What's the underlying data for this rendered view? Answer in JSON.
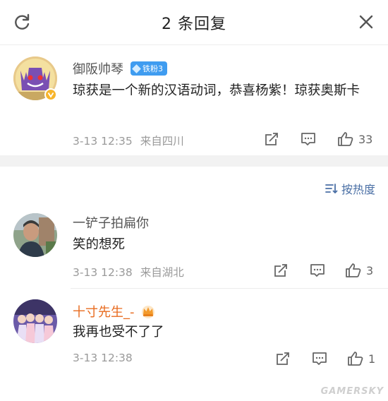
{
  "header": {
    "title": "2 条回复",
    "refresh_icon": "refresh-icon",
    "close_icon": "close-icon"
  },
  "main_comment": {
    "author": "御阪帅琴",
    "fan_badge": "铁粉3",
    "content": "琼获是一个新的汉语动词，恭喜杨紫！琼获奥斯卡",
    "time": "3-13 12:35",
    "location": "来自四川",
    "likes": "33"
  },
  "sort": {
    "label": "按热度"
  },
  "replies": [
    {
      "author": "一铲子拍扁你",
      "content": "笑的想死",
      "time": "3-13 12:38",
      "location": "来自湖北",
      "likes": "3"
    },
    {
      "author": "十寸先生_-",
      "content": "我再也受不了了",
      "time": "3-13 12:38",
      "location": "",
      "likes": "1"
    }
  ],
  "watermark": "GAMERSKY",
  "colors": {
    "link_blue": "#4a6fa5",
    "badge_blue": "#3f9cf0",
    "vip_orange": "#e86b1f",
    "verify_gold": "#f7b52c"
  }
}
